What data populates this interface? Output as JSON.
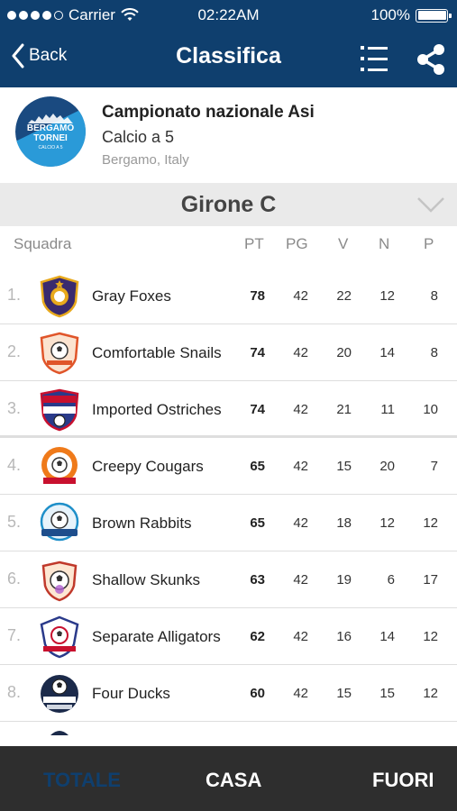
{
  "status_bar": {
    "carrier": "Carrier",
    "time": "02:22AM",
    "battery": "100%"
  },
  "nav": {
    "back_label": "Back",
    "title": "Classifica"
  },
  "tournament": {
    "logo_line1": "BERGAMO",
    "logo_line2": "TORNEI",
    "logo_line3": "CALCIO A 5",
    "name": "Campionato nazionale Asi",
    "sport": "Calcio a 5",
    "location": "Bergamo, Italy"
  },
  "group": {
    "title": "Girone C"
  },
  "columns": {
    "team": "Squadra",
    "pt": "PT",
    "pg": "PG",
    "v": "V",
    "n": "N",
    "p": "P"
  },
  "rows": [
    {
      "pos": "1.",
      "team": "Gray Foxes",
      "pt": "78",
      "pg": "42",
      "v": "22",
      "n": "12",
      "p": "8",
      "badge": "shield-star-badge-icon"
    },
    {
      "pos": "2.",
      "team": "Comfortable Snails",
      "pt": "74",
      "pg": "42",
      "v": "20",
      "n": "14",
      "p": "8",
      "badge": "shield-ball-badge-icon"
    },
    {
      "pos": "3.",
      "team": "Imported Ostriches",
      "pt": "74",
      "pg": "42",
      "v": "21",
      "n": "11",
      "p": "10",
      "badge": "football-champions-badge-icon"
    },
    {
      "pos": "4.",
      "team": "Creepy Cougars",
      "pt": "65",
      "pg": "42",
      "v": "15",
      "n": "20",
      "p": "7",
      "badge": "fc-united-badge-icon"
    },
    {
      "pos": "5.",
      "team": "Brown Rabbits",
      "pt": "65",
      "pg": "42",
      "v": "18",
      "n": "12",
      "p": "12",
      "badge": "soccer-badge-icon"
    },
    {
      "pos": "6.",
      "team": "Shallow Skunks",
      "pt": "63",
      "pg": "42",
      "v": "19",
      "n": "6",
      "p": "17",
      "badge": "shield-ball-badge-icon"
    },
    {
      "pos": "7.",
      "team": "Separate Alligators",
      "pt": "62",
      "pg": "42",
      "v": "16",
      "n": "14",
      "p": "12",
      "badge": "fc-united-badge-icon"
    },
    {
      "pos": "8.",
      "team": "Four Ducks",
      "pt": "60",
      "pg": "42",
      "v": "15",
      "n": "15",
      "p": "12",
      "badge": "soccer-club-badge-icon"
    }
  ],
  "tabs": [
    {
      "label": "TOTALE",
      "active": true
    },
    {
      "label": "CASA",
      "active": false
    },
    {
      "label": "FUORI",
      "active": false
    }
  ],
  "colors": {
    "header_bg": "#0f3f6e",
    "tab_bar_bg": "#2e2e2e",
    "group_bar_bg": "#eaeaea"
  }
}
